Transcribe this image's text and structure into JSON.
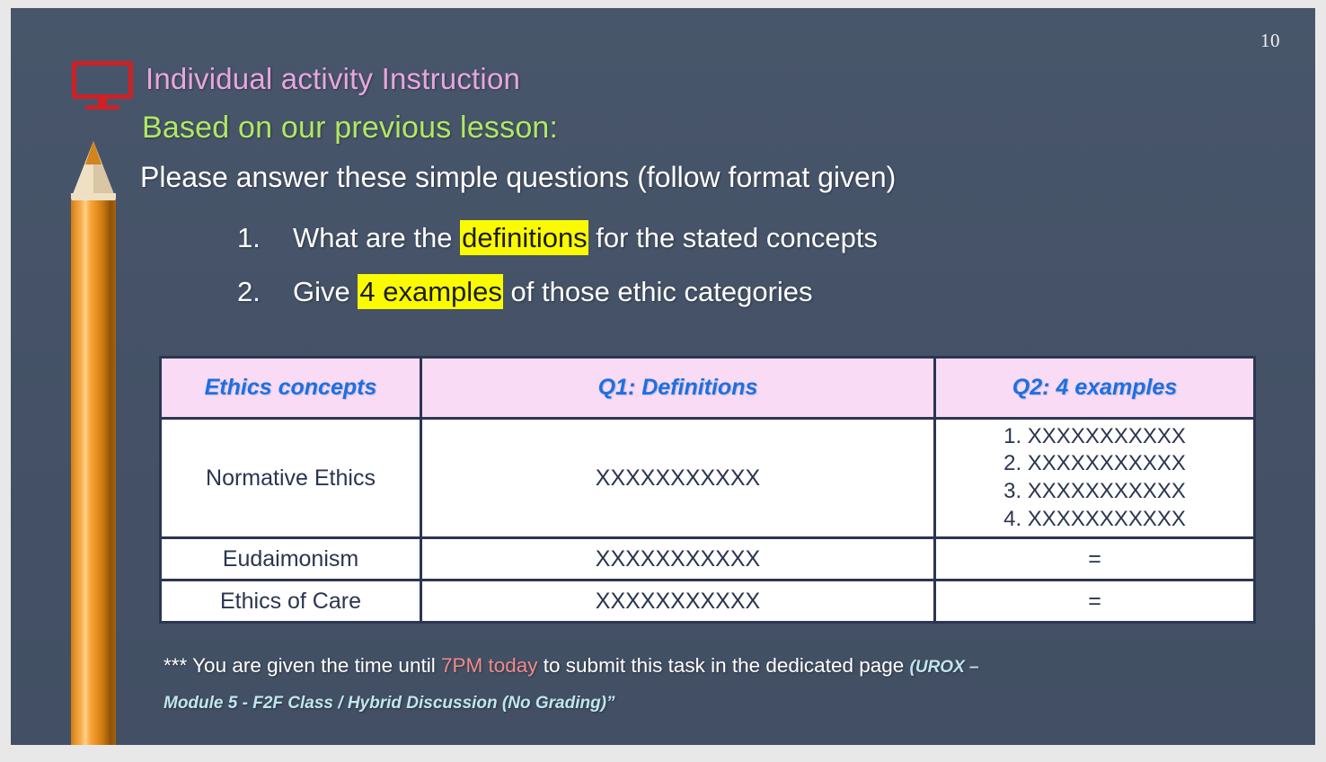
{
  "slide": {
    "page_number": "10",
    "background_color": "#465469",
    "accent_pink": "#e8a6e0",
    "accent_green": "#b0e864",
    "highlight_color": "#fbfb00",
    "table_header_bg": "#f9dbf6",
    "table_header_text_color": "#1f6fe0",
    "table_border_color": "#2c3552",
    "icon_color": "#cc2127"
  },
  "header": {
    "title": "Individual activity Instruction",
    "subtitle": "Based on our previous lesson:",
    "instruction": "Please answer these simple questions (follow format given)",
    "monitor_icon": "monitor-icon",
    "pencil_icon": "pencil-icon"
  },
  "questions": [
    {
      "number": "1.",
      "before": "What are the ",
      "highlight": "definitions",
      "after": " for the stated concepts"
    },
    {
      "number": "2.",
      "before": "Give ",
      "highlight": "4 examples",
      "after": " of those ethic categories"
    }
  ],
  "table": {
    "columns": [
      "Ethics concepts",
      "Q1: Definitions",
      "Q2: 4 examples"
    ],
    "rows": [
      {
        "concept": "Normative Ethics",
        "definition": "XXXXXXXXXXX",
        "examples": [
          "1. XXXXXXXXXXX",
          "2. XXXXXXXXXXX",
          "3. XXXXXXXXXXX",
          "4. XXXXXXXXXXX"
        ]
      },
      {
        "concept": "Eudaimonism",
        "definition": "XXXXXXXXXXX",
        "examples_short": "="
      },
      {
        "concept": "Ethics of Care",
        "definition": "XXXXXXXXXXX",
        "examples_short": "="
      }
    ]
  },
  "footnote": {
    "part1": "*** You are given the time until ",
    "time": "7PM today",
    "part2": " to submit this task in the dedicated page ",
    "reference": "(UROX –",
    "line2": "Module 5 - F2F Class / Hybrid Discussion (No Grading)”"
  }
}
